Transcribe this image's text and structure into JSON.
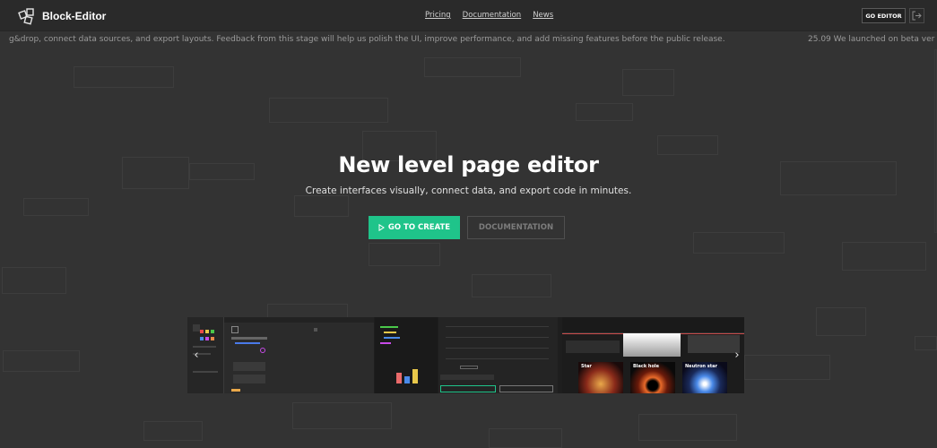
{
  "brand": {
    "name": "Block-Editor"
  },
  "nav": {
    "links": [
      "Pricing",
      "Documentation",
      "News"
    ],
    "go_editor": "GO EDITOR"
  },
  "ticker": {
    "text_a": "g&drop, connect data sources, and export layouts. Feedback from this stage will help us polish the UI, improve performance, and add missing features before the public release.",
    "text_b": "25.09 We launched on beta ver"
  },
  "hero": {
    "title": "New level page editor",
    "subtitle": "Create interfaces visually, connect data, and export code in minutes.",
    "cta_create": "GO TO CREATE",
    "cta_docs": "DOCUMENTATION"
  },
  "gallery": {
    "labels": [
      "Star",
      "Black hole",
      "Neutron star"
    ]
  },
  "colors": {
    "background": "#333333",
    "topbar": "#2a2a2a",
    "accent": "#1fc48a"
  }
}
